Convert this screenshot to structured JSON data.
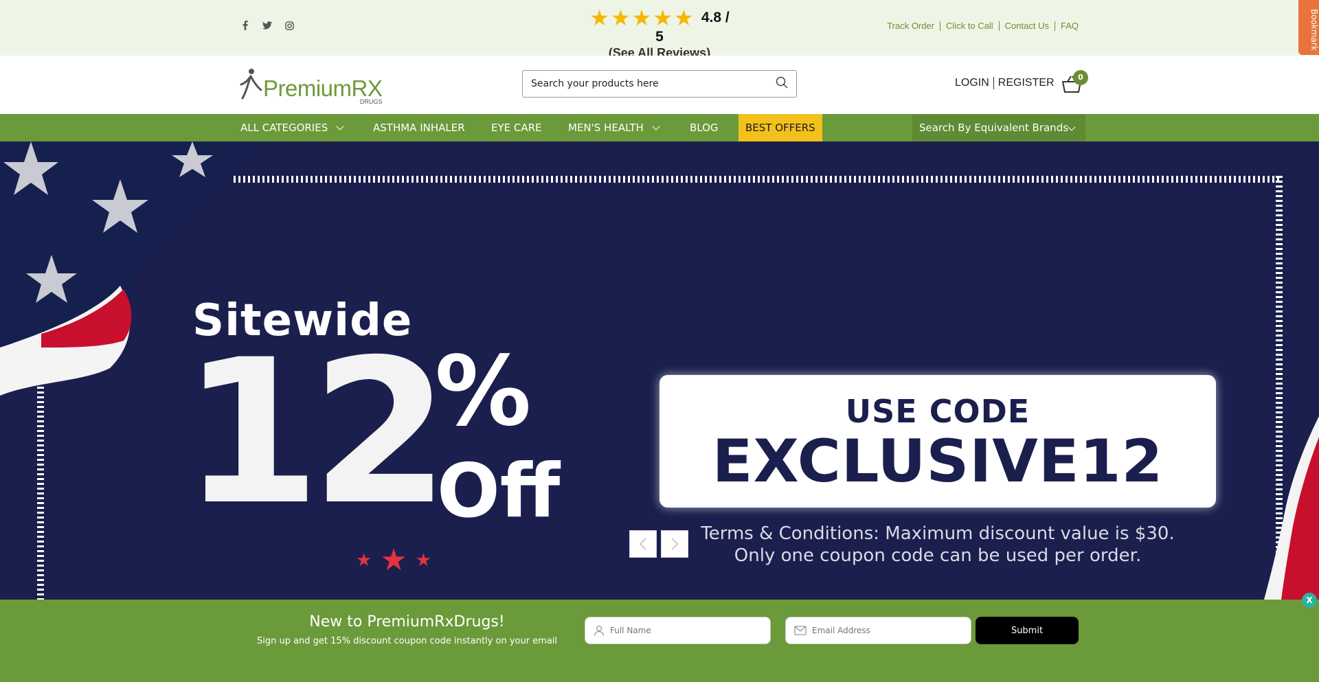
{
  "topbar": {
    "social": [
      "facebook-icon",
      "twitter-icon",
      "instagram-icon"
    ],
    "rating": {
      "stars": 5,
      "value": "4.8 / 5",
      "reviews_link": "(See All Reviews)"
    },
    "links": [
      "Track Order",
      "Click to Call",
      "Contact Us",
      "FAQ"
    ],
    "bookmark": "Bookmark"
  },
  "header": {
    "logo_text": "PremiumRX",
    "logo_sub": "DRUGS",
    "search_placeholder": "Search your products here",
    "login": "LOGIN",
    "register": "REGISTER",
    "cart_count": "0"
  },
  "nav": {
    "items": [
      {
        "label": "ALL CATEGORIES",
        "dropdown": true
      },
      {
        "label": "ASTHMA INHALER",
        "dropdown": false
      },
      {
        "label": "EYE CARE",
        "dropdown": false
      },
      {
        "label": "MEN'S HEALTH",
        "dropdown": true
      },
      {
        "label": "BLOG",
        "dropdown": false
      },
      {
        "label": "BEST OFFERS",
        "dropdown": false
      }
    ],
    "equivalent_brands": "Search By Equivalent Brands"
  },
  "hero": {
    "sitewide": "Sitewide",
    "big_number": "12",
    "percent": "%",
    "off": "Off",
    "code_label": "USE CODE",
    "code_value": "EXCLUSIVE12",
    "terms_line1": "Terms & Conditions: Maximum discount value is $30.",
    "terms_line2": "Only one coupon code can be used per order."
  },
  "signup": {
    "title": "New to PremiumRxDrugs!",
    "subtitle": "Sign up and get 15% discount coupon code instantly on your email",
    "name_placeholder": "Full Name",
    "email_placeholder": "Email Address",
    "submit_label": "Submit",
    "close_label": "X"
  },
  "colors": {
    "brand_green": "#6b9a3a",
    "nav_bg": "#6b9a3a",
    "best_offers": "#f2c11c",
    "hero_navy": "#1b1f4d",
    "star_gold": "#f5b800",
    "bookmark_orange": "#e8743b"
  }
}
